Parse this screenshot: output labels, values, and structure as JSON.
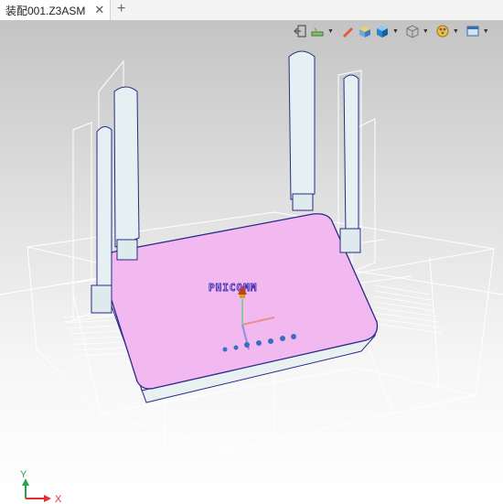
{
  "document_tab": {
    "title": "装配001.Z3ASM",
    "close_symbol": "✕",
    "add_symbol": "+"
  },
  "viewport": {
    "toolbar_icons": [
      "exit-icon",
      "layer-tool-icon",
      "pencil-icon",
      "render-shaded-icon",
      "cube-view-icon",
      "wireframe-cube-icon",
      "palette-icon",
      "window-icon"
    ],
    "model_brand_label": "PHICOMM",
    "status_icon_count": 7,
    "triad": {
      "x_label": "X",
      "y_label": "Y"
    }
  },
  "colors": {
    "router_body": "#f2b8f0",
    "router_outline": "#2a2a8a",
    "antenna_fill": "#e4f0f2",
    "wireframe": "#ffffff",
    "axis_x": "#e03030",
    "axis_y": "#22a84a"
  }
}
